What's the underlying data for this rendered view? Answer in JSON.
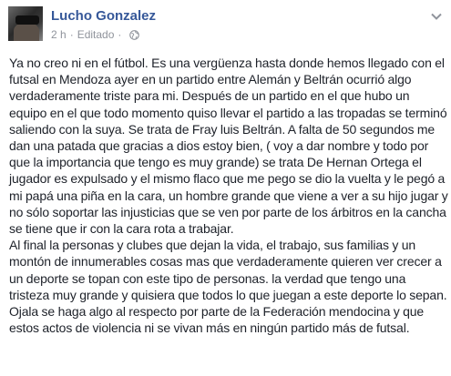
{
  "post": {
    "author": "Lucho Gonzalez",
    "time": "2 h",
    "separator": "·",
    "edited": "Editado",
    "paragraphs": [
      "Ya no creo ni en el fútbol. Es una vergüenza hasta donde hemos llegado con el futsal en Mendoza ayer en un partido entre Alemán y Beltrán ocurrió algo verdaderamente triste para mi. Después de un partido en el que hubo un equipo en el que todo momento quiso llevar el partido a las tropadas se terminó saliendo con la suya. Se trata de Fray luis Beltrán. A falta de 50 segundos me dan una patada que gracias a dios estoy bien, ( voy a dar nombre y todo por que la importancia que tengo es muy grande) se trata De Hernan Ortega el jugador es expulsado y el mismo flaco que me pego se dio la vuelta y le pegó a mi papá una piña en la cara, un hombre grande que viene a ver a su hijo jugar y no sólo soportar las injusticias que se ven por parte de los árbitros en la cancha se tiene que ir con la cara rota a trabajar.",
      "Al final la personas y clubes que dejan la vida, el trabajo, sus familias y un montón de innumerables cosas mas que verdaderamente quieren ver crecer a un deporte se topan con este tipo de personas. la verdad que tengo una tristeza muy grande y quisiera que todos lo que juegan a este deporte lo sepan.",
      "Ojala se haga algo al respecto por parte de la Federación mendocina y que estos actos de violencia ni se vivan más en ningún partido más de futsal."
    ]
  },
  "icons": {
    "audience": "globe-icon",
    "menu": "chevron-down-icon"
  },
  "colors": {
    "author_link": "#365899",
    "meta_text": "#90949c",
    "body_text": "#1d2129"
  }
}
